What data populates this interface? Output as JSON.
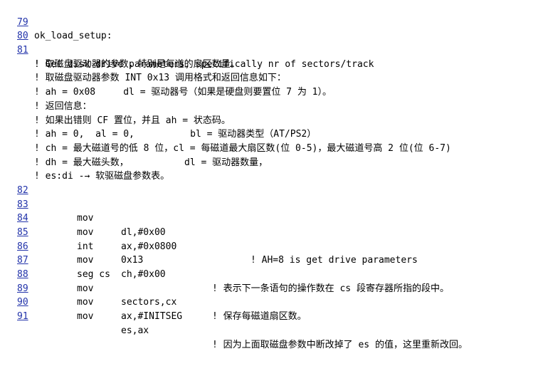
{
  "lines": [
    {
      "n": "79",
      "label": "ok_load_setup:"
    },
    {
      "n": "80"
    },
    {
      "n": "81",
      "comment": "! Get disk drive parameters, specifically nr of sectors/track"
    },
    {
      "comment": "! 取磁盘驱动器的参数，特别是每道的扇区数量。"
    },
    {
      "comment": "! 取磁盘驱动器参数 INT 0x13 调用格式和返回信息如下："
    },
    {
      "comment": "! ah = 0x08     dl = 驱动器号（如果是硬盘则要置位 7 为 1）。"
    },
    {
      "comment": "! 返回信息："
    },
    {
      "comment": "! 如果出错则 CF 置位，并且 ah = 状态码。"
    },
    {
      "comment": "! ah = 0,  al = 0,          bl = 驱动器类型（AT/PS2）"
    },
    {
      "comment": "! ch = 最大磁道号的低 8 位，cl = 每磁道最大扇区数(位 0-5)，最大磁道号高 2 位(位 6-7)"
    },
    {
      "comment": "! dh = 最大磁头数，          dl = 驱动器数量，"
    },
    {
      "comment": "! es:di -→ 软驱磁盘参数表。"
    },
    {
      "n": "82"
    },
    {
      "n": "83",
      "op": "mov",
      "args": "dl,#0x00"
    },
    {
      "n": "84",
      "op": "mov",
      "args": "ax,#0x0800",
      "remark": "! AH=8 is get drive parameters",
      "remark_col": "far"
    },
    {
      "n": "85",
      "op": "int",
      "args": "0x13"
    },
    {
      "n": "86",
      "op": "mov",
      "args": "ch,#0x00"
    },
    {
      "n": "87",
      "op": "seg cs",
      "remark": "! 表示下一条语句的操作数在 cs 段寄存器所指的段中。",
      "remark_col": "near"
    },
    {
      "n": "88",
      "op": "mov",
      "args": "sectors,cx",
      "remark": "! 保存每磁道扇区数。",
      "remark_col": "near"
    },
    {
      "n": "89",
      "op": "mov",
      "args": "ax,#INITSEG"
    },
    {
      "n": "90",
      "op": "mov",
      "args": "es,ax",
      "remark": "! 因为上面取磁盘参数中断改掉了 es 的值，这里重新改回。",
      "remark_col": "near"
    },
    {
      "n": "91"
    }
  ]
}
